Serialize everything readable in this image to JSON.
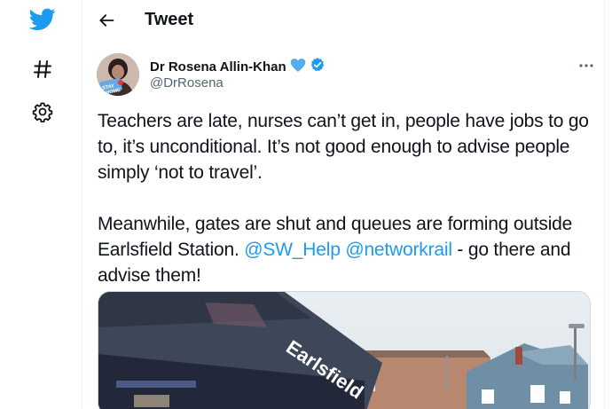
{
  "colors": {
    "brand": "#1d9bf0",
    "text": "#0f1419",
    "muted": "#536471"
  },
  "nav": {
    "items": [
      {
        "icon": "twitter-bird-icon"
      },
      {
        "icon": "hashtag-icon"
      },
      {
        "icon": "gear-icon"
      }
    ]
  },
  "header": {
    "title": "Tweet",
    "back_icon": "arrow-left-icon"
  },
  "author": {
    "display_name": "Dr Rosena Allin-Khan",
    "emoji": "blue-heart",
    "verified": true,
    "handle": "@DrRosena",
    "avatar_badge_text": "STAY HOME"
  },
  "tweet": {
    "text_1": "Teachers are late, nurses can’t get in, people have jobs to go to, it’s unconditional. It’s not good enough to advise people simply ‘not to travel’.\n\nMeanwhile, gates are shut and queues are forming outside Earlsfield Station. ",
    "mention_1": "@SW_Help",
    "space": " ",
    "mention_2": "@networkrail",
    "text_2": " - go there and advise them!"
  },
  "media": {
    "sign_text": "Earlsfield"
  }
}
